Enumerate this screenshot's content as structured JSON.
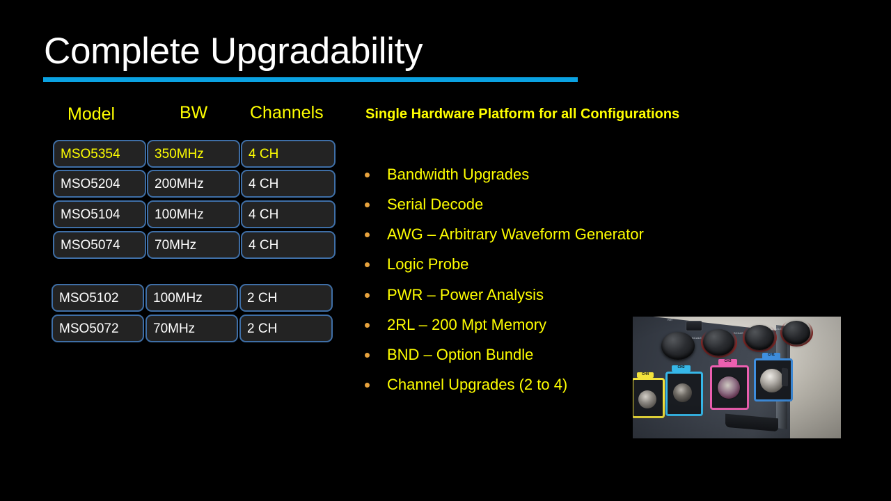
{
  "slide": {
    "title": "Complete Upgradability",
    "accent_color": "#0aa2e2",
    "background_color": "#000000",
    "highlight_color": "#ffff00",
    "bullet_dot_color": "#e8a33d",
    "cell_border_color": "#3f6fa7",
    "cell_fill_color": "#232323"
  },
  "table": {
    "headers": {
      "model": "Model",
      "bw": "BW",
      "channels": "Channels"
    },
    "group_4ch": [
      {
        "model": "MSO5354",
        "bw": "350MHz",
        "channels": "4 CH",
        "highlighted": true
      },
      {
        "model": "MSO5204",
        "bw": "200MHz",
        "channels": "4 CH",
        "highlighted": false
      },
      {
        "model": "MSO5104",
        "bw": "100MHz",
        "channels": "4 CH",
        "highlighted": false
      },
      {
        "model": "MSO5074",
        "bw": "70MHz",
        "channels": "4 CH",
        "highlighted": false
      }
    ],
    "group_2ch": [
      {
        "model": "MSO5102",
        "bw": "100MHz",
        "channels": "2 CH",
        "highlighted": false
      },
      {
        "model": "MSO5072",
        "bw": "70MHz",
        "channels": "2 CH",
        "highlighted": false
      }
    ]
  },
  "right_panel": {
    "subheading": "Single Hardware Platform for all Configurations",
    "bullets": [
      "Bandwidth Upgrades",
      "Serial Decode",
      "AWG – Arbitrary Waveform Generator",
      "Logic Probe",
      "PWR – Power Analysis",
      "2RL – 200 Mpt Memory",
      "BND – Option Bundle",
      "Channel Upgrades (2 to 4)"
    ]
  },
  "photo": {
    "caption": "oscilloscope-front-panel-photo",
    "channel_labels": {
      "ch1": "CH1",
      "ch2": "CH2",
      "ch3": "CH3",
      "ch4": "CH4"
    },
    "knob_label": "SCALE",
    "ref_button_label": "Ref"
  }
}
